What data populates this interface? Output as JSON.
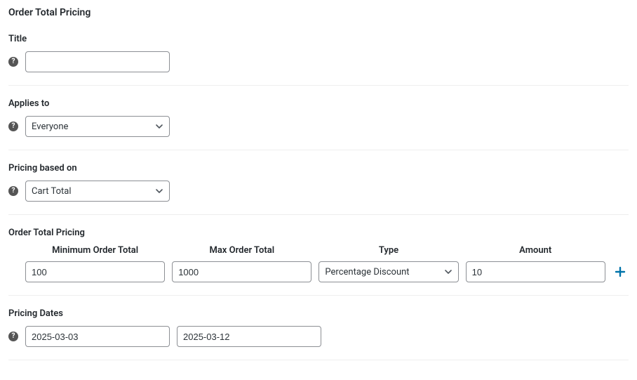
{
  "page_title": "Order Total Pricing",
  "sections": {
    "title": {
      "label": "Title",
      "value": ""
    },
    "applies_to": {
      "label": "Applies to",
      "value": "Everyone"
    },
    "pricing_based_on": {
      "label": "Pricing based on",
      "value": "Cart Total"
    },
    "order_total_pricing": {
      "label": "Order Total Pricing",
      "columns": {
        "min": "Minimum Order Total",
        "max": "Max Order Total",
        "type": "Type",
        "amount": "Amount"
      },
      "row": {
        "min": "100",
        "max": "1000",
        "type": "Percentage Discount",
        "amount": "10"
      }
    },
    "pricing_dates": {
      "label": "Pricing Dates",
      "from": "2025-03-03",
      "to": "2025-03-12"
    }
  }
}
